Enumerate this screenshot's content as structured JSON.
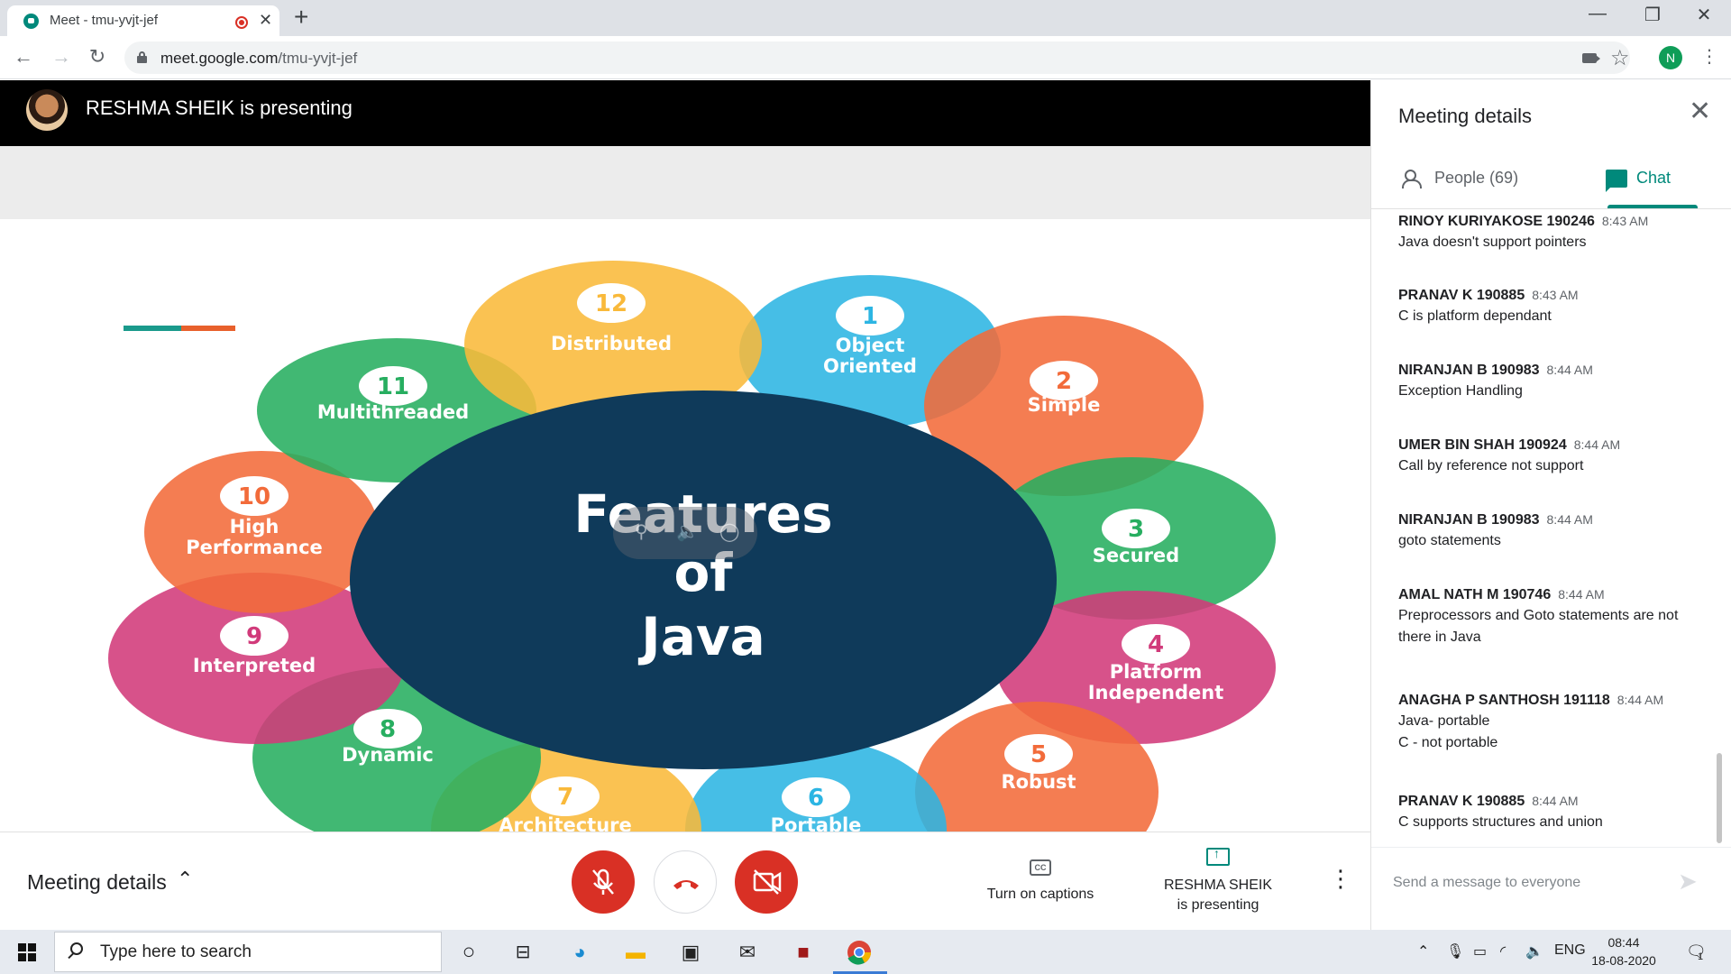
{
  "browser": {
    "tab_title": "Meet - tmu-yvjt-jef",
    "tab_close": "✕",
    "new_tab": "+",
    "url_host": "meet.google.com",
    "url_path": "/tmu-yvjt-jef",
    "profile_initial": "N",
    "window_controls": [
      "—",
      "❐",
      "✕"
    ]
  },
  "presenter": {
    "banner": "RESHMA SHEIK is presenting"
  },
  "slide": {
    "title_lines": [
      "Features",
      "of",
      "Java"
    ],
    "features": [
      {
        "num": "1",
        "label": [
          "Object",
          "Oriented"
        ],
        "color": "#2cb5e3"
      },
      {
        "num": "2",
        "label": [
          "Simple"
        ],
        "color": "#f26b3a"
      },
      {
        "num": "3",
        "label": [
          "Secured"
        ],
        "color": "#27ae60"
      },
      {
        "num": "4",
        "label": [
          "Platform",
          "Independent"
        ],
        "color": "#d13a7a"
      },
      {
        "num": "5",
        "label": [
          "Robust"
        ],
        "color": "#f26b3a"
      },
      {
        "num": "6",
        "label": [
          "Portable"
        ],
        "color": "#2cb5e3"
      },
      {
        "num": "7",
        "label": [
          "Architecture"
        ],
        "color": "#f9b93a"
      },
      {
        "num": "8",
        "label": [
          "Dynamic"
        ],
        "color": "#27ae60"
      },
      {
        "num": "9",
        "label": [
          "Interpreted"
        ],
        "color": "#d13a7a"
      },
      {
        "num": "10",
        "label": [
          "High",
          "Performance"
        ],
        "color": "#f26b3a"
      },
      {
        "num": "11",
        "label": [
          "Multithreaded"
        ],
        "color": "#27ae60"
      },
      {
        "num": "12",
        "label": [
          "Distributed"
        ],
        "color": "#f9b93a"
      }
    ],
    "center_color": "#0f3a5a"
  },
  "controls": {
    "meeting_details": "Meeting details",
    "captions": "Turn on captions",
    "presenting_name": "RESHMA SHEIK",
    "presenting_suffix": "is presenting"
  },
  "panel": {
    "title": "Meeting details",
    "people_tab": "People (69)",
    "chat_tab": "Chat",
    "input_placeholder": "Send a message to everyone",
    "messages": [
      {
        "author": "RINOY KURIYAKOSE 190246",
        "time": "8:43 AM",
        "lines": [
          "Java doesn't support pointers"
        ]
      },
      {
        "author": "PRANAV K 190885",
        "time": "8:43 AM",
        "lines": [
          "C is platform dependant"
        ]
      },
      {
        "author": "NIRANJAN B 190983",
        "time": "8:44 AM",
        "lines": [
          "Exception Handling"
        ]
      },
      {
        "author": "UMER BIN SHAH 190924",
        "time": "8:44 AM",
        "lines": [
          "Call by reference not support"
        ]
      },
      {
        "author": "NIRANJAN B 190983",
        "time": "8:44 AM",
        "lines": [
          "goto statements"
        ]
      },
      {
        "author": "AMAL NATH M 190746",
        "time": "8:44 AM",
        "lines": [
          "Preprocessors and Goto statements are not",
          "there in Java"
        ]
      },
      {
        "author": "ANAGHA P SANTHOSH 191118",
        "time": "8:44 AM",
        "lines": [
          "Java- portable",
          "C - not portable"
        ]
      },
      {
        "author": "PRANAV K 190885",
        "time": "8:44 AM",
        "lines": [
          "C supports structures and union"
        ]
      }
    ]
  },
  "taskbar": {
    "search_placeholder": "Type here to search",
    "language": "ENG",
    "time": "08:44",
    "date": "18-08-2020",
    "notification_count": "1"
  }
}
